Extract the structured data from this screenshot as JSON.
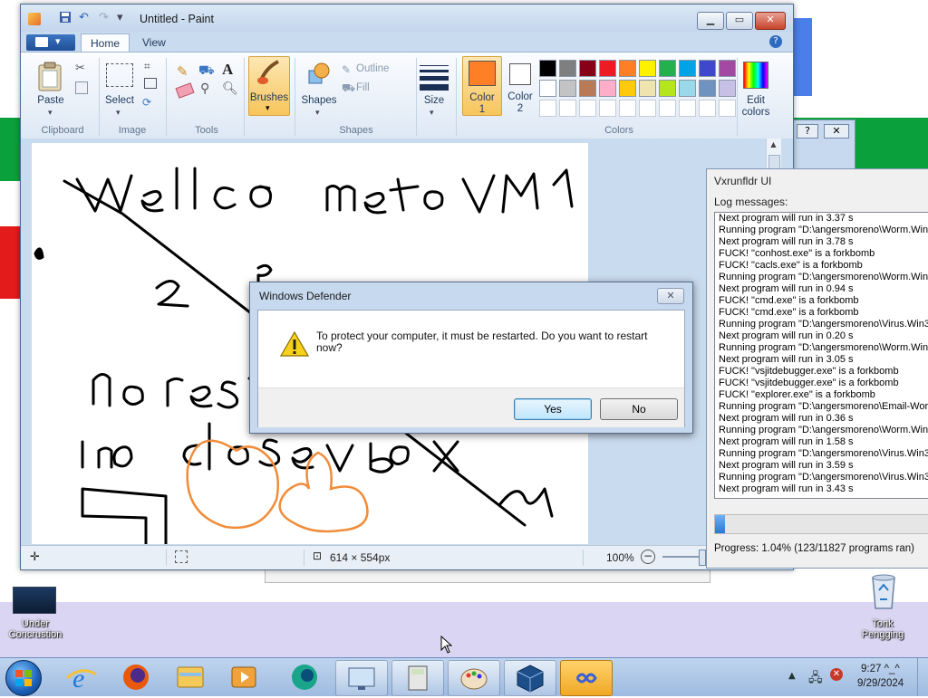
{
  "paint": {
    "title": "Untitled - Paint",
    "tabs": [
      "Home",
      "View"
    ],
    "groups": {
      "clipboard": "Clipboard",
      "image": "Image",
      "tools": "Tools",
      "shapes": "Shapes",
      "colors": "Colors"
    },
    "buttons": {
      "paste": "Paste",
      "select": "Select",
      "brushes": "Brushes",
      "shapes": "Shapes",
      "outline": "Outline",
      "fill": "Fill",
      "size": "Size",
      "color1_line1": "Color",
      "color1_line2": "1",
      "color2_line1": "Color",
      "color2_line2": "2",
      "edit_colors_line1": "Edit",
      "edit_colors_line2": "colors"
    },
    "palette": [
      "#000000",
      "#7f7f7f",
      "#880015",
      "#ed1c24",
      "#ff7f27",
      "#fff200",
      "#22b14c",
      "#00a2e8",
      "#3f48cc",
      "#a349a4",
      "#ffffff",
      "#c3c3c3",
      "#b97a57",
      "#ffaec9",
      "#ffc90e",
      "#efe4b0",
      "#b5e61d",
      "#99d9ea",
      "#7092be",
      "#c8bfe7"
    ],
    "color1": "#ff7f27",
    "status": {
      "dimensions": "614 × 554px",
      "zoom": "100%"
    }
  },
  "defender": {
    "title": "Windows Defender",
    "message": "To protect your computer, it must be restarted. Do you want to restart now?",
    "yes": "Yes",
    "no": "No"
  },
  "vx": {
    "title": "Vxrunfldr UI",
    "log_label": "Log messages:",
    "log": [
      "Next program will run in 3.37 s",
      "Running program \"D:\\angersmoreno\\Worm.Win3",
      "Next program will run in 3.78 s",
      "FUCK! \"conhost.exe\" is a forkbomb",
      "FUCK! \"cacls.exe\" is a forkbomb",
      "Running program \"D:\\angersmoreno\\Worm.Win3",
      "Next program will run in 0.94 s",
      "FUCK! \"cmd.exe\" is a forkbomb",
      "FUCK! \"cmd.exe\" is a forkbomb",
      "Running program \"D:\\angersmoreno\\Virus.Win32",
      "Next program will run in 0.20 s",
      "Running program \"D:\\angersmoreno\\Worm.Win3",
      "Next program will run in 3.05 s",
      "FUCK! \"vsjitdebugger.exe\" is a forkbomb",
      "FUCK! \"vsjitdebugger.exe\" is a forkbomb",
      "FUCK! \"explorer.exe\" is a forkbomb",
      "Running program \"D:\\angersmoreno\\Email-Worm",
      "Next program will run in 0.36 s",
      "Running program \"D:\\angersmoreno\\Worm.Win3",
      "Next program will run in 1.58 s",
      "Running program \"D:\\angersmoreno\\Virus.Win32",
      "Next program will run in 3.59 s",
      "Running program \"D:\\angersmoreno\\Virus.Win32",
      "Next program will run in 3.43 s"
    ],
    "progress_fraction": 0.0104,
    "progress_text": "Progress: 1.04% (123/11827 programs ran)"
  },
  "desktop": {
    "icon_left": "Under Concrustion",
    "icon_right": "Tonk Pengging"
  },
  "taskbar": {
    "time": "9:27",
    "time_suffix": "^_^",
    "date": "9/29/2024",
    "items": [
      "start-orb-icon",
      "internet-explorer-icon",
      "firefox-icon",
      "file-explorer-icon",
      "media-player-icon",
      "browser-icon",
      "remote-desktop-icon",
      "calculator-icon",
      "paint-icon",
      "virtualbox-icon",
      "loop-app-icon"
    ]
  }
}
